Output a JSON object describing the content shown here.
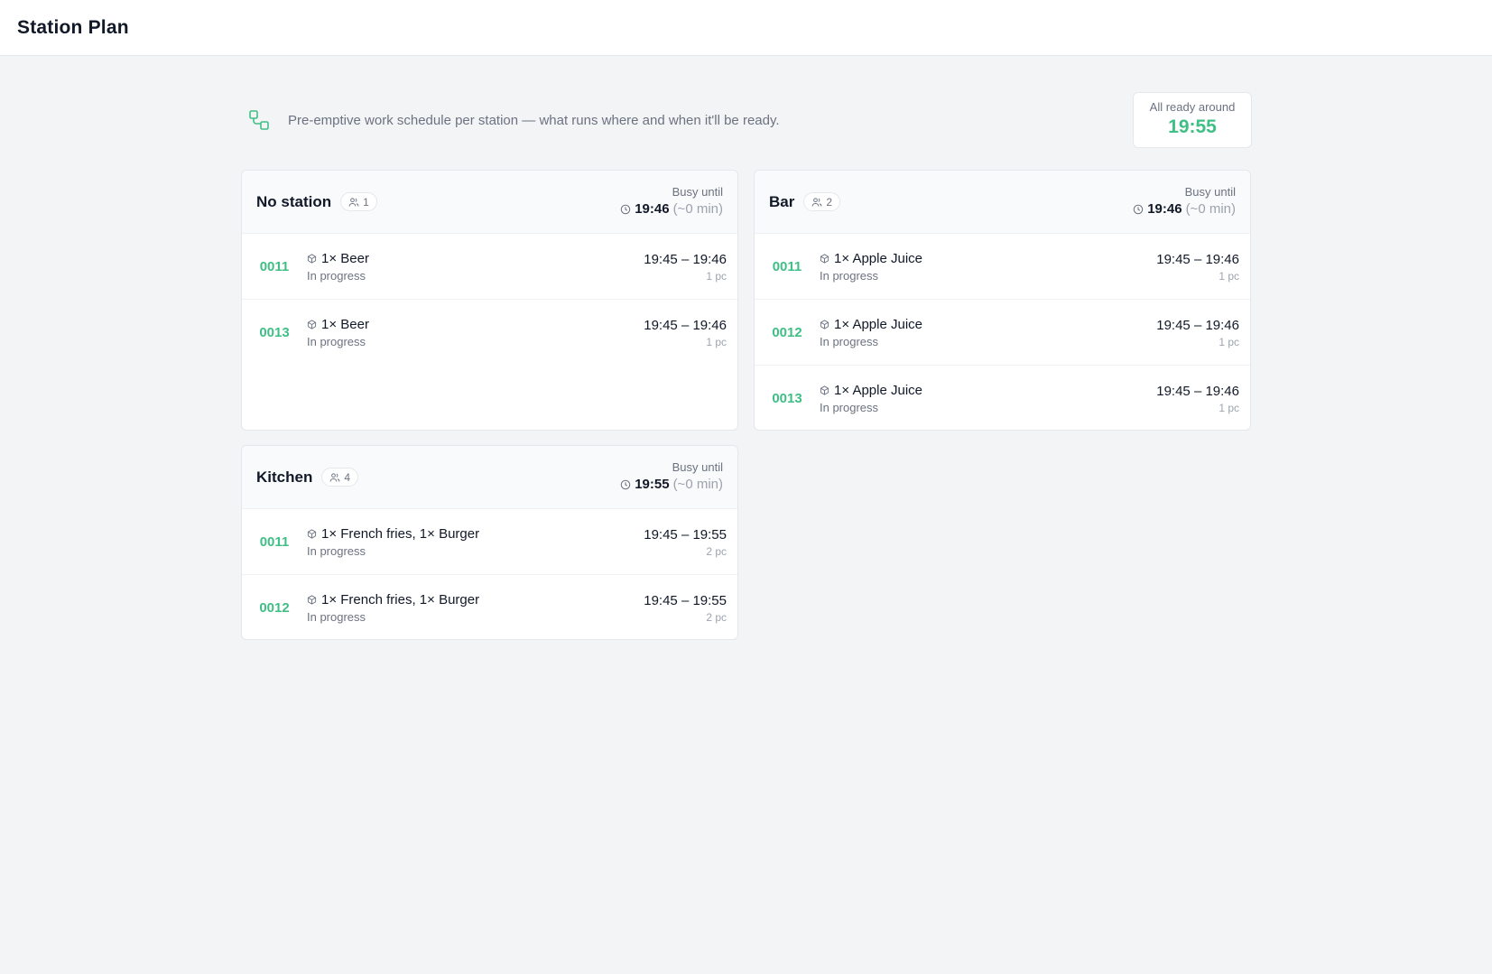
{
  "header": {
    "title": "Station Plan"
  },
  "intro": {
    "icon": "workflow-icon",
    "description": "Pre-emptive work schedule per station — what runs where and when it'll be ready.",
    "ready_label": "All ready around",
    "ready_time": "19:55"
  },
  "colors": {
    "accent": "#3fbf85",
    "background": "#f3f4f6"
  },
  "stations": {
    "no_station": {
      "title": "No station",
      "count": "1",
      "busy_label": "Busy until",
      "busy_time": "19:46",
      "busy_delta": "(~0 min)",
      "rows": [
        {
          "order": "0011",
          "items": "1× Beer",
          "status": "In progress",
          "range": "19:45 – 19:46",
          "qty": "1 pc"
        },
        {
          "order": "0013",
          "items": "1× Beer",
          "status": "In progress",
          "range": "19:45 – 19:46",
          "qty": "1 pc"
        }
      ]
    },
    "bar": {
      "title": "Bar",
      "count": "2",
      "busy_label": "Busy until",
      "busy_time": "19:46",
      "busy_delta": "(~0 min)",
      "rows": [
        {
          "order": "0011",
          "items": "1× Apple Juice",
          "status": "In progress",
          "range": "19:45 – 19:46",
          "qty": "1 pc"
        },
        {
          "order": "0012",
          "items": "1× Apple Juice",
          "status": "In progress",
          "range": "19:45 – 19:46",
          "qty": "1 pc"
        },
        {
          "order": "0013",
          "items": "1× Apple Juice",
          "status": "In progress",
          "range": "19:45 – 19:46",
          "qty": "1 pc"
        }
      ]
    },
    "kitchen": {
      "title": "Kitchen",
      "count": "4",
      "busy_label": "Busy until",
      "busy_time": "19:55",
      "busy_delta": "(~0 min)",
      "rows": [
        {
          "order": "0011",
          "items": "1× French fries, 1× Burger",
          "status": "In progress",
          "range": "19:45 – 19:55",
          "qty": "2 pc"
        },
        {
          "order": "0012",
          "items": "1× French fries, 1× Burger",
          "status": "In progress",
          "range": "19:45 – 19:55",
          "qty": "2 pc"
        }
      ]
    }
  }
}
